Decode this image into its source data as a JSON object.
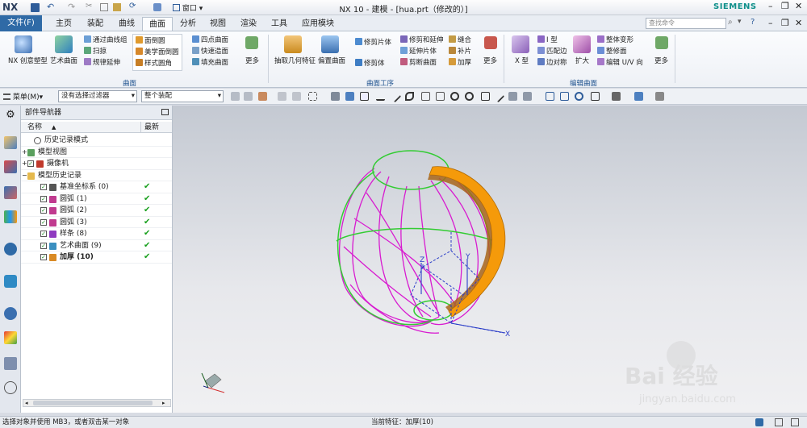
{
  "app": {
    "logo": "NX",
    "title": "NX 10 - 建模 - [hua.prt（修改的）]",
    "brand": "SIEMENS",
    "window_menu": "窗口",
    "search_placeholder": "查找命令"
  },
  "menu": {
    "file": "文件(F)",
    "tabs": [
      "主页",
      "装配",
      "曲线",
      "曲面",
      "分析",
      "视图",
      "渲染",
      "工具",
      "应用模块"
    ]
  },
  "ribbon": {
    "creative": "NX 创意塑型",
    "art_surface": "艺术曲面",
    "through_curve_group": "通过曲线组",
    "sweep": "扫掠",
    "rule_extend": "规律延伸",
    "face_round": "面倒圆",
    "aesthetic_round": "美学面倒圆",
    "style_round": "样式圆角",
    "four_point": "四点曲面",
    "quick_build": "快速造面",
    "fill_surface": "填充曲面",
    "more": "更多",
    "extract_geometry": "抽取几何特征",
    "offset_surface": "偏置曲面",
    "trim_sheet": "修剪片体",
    "trim_extend": "修剪和延伸",
    "stitch": "缝合",
    "trim_body": "修剪体",
    "extend_sheet": "延伸片体",
    "patch": "补片",
    "delete_edge": "剪断曲面",
    "thicken": "加厚",
    "x_form": "X 型",
    "i_form": "I 型",
    "match_edge": "匹配边",
    "edge_symmetry": "边对称",
    "enlarge": "扩大",
    "global_shaping": "整体变形",
    "edit_surface": "整修面",
    "edit_uv": "编辑 U/V 向",
    "group_surface": "曲面",
    "group_surface_ops": "曲面工序",
    "group_edit_surface": "编辑曲面"
  },
  "toolbar": {
    "menu": "菜单(M)▾",
    "filter": "没有选择过滤器",
    "scope": "整个装配"
  },
  "navigator": {
    "title": "部件导航器",
    "col_name": "名称",
    "col_latest": "最新",
    "rows": [
      {
        "label": "历史记录模式",
        "check": ""
      },
      {
        "label": "模型视图",
        "check": ""
      },
      {
        "label": "摄像机",
        "check": ""
      },
      {
        "label": "模型历史记录",
        "check": ""
      },
      {
        "label": "基准坐标系 (0)",
        "check": "✔"
      },
      {
        "label": "圆弧 (1)",
        "check": "✔"
      },
      {
        "label": "圆弧 (2)",
        "check": "✔"
      },
      {
        "label": "圆弧 (3)",
        "check": "✔"
      },
      {
        "label": "样条 (8)",
        "check": "✔"
      },
      {
        "label": "艺术曲面 (9)",
        "check": "✔"
      },
      {
        "label": "加厚 (10)",
        "check": "✔"
      }
    ]
  },
  "viewport": {
    "axis_x": "X",
    "axis_y": "Y",
    "axis_z": "Z"
  },
  "watermark": {
    "main": "Bai 经验",
    "sub": "jingyan.baidu.com"
  },
  "status": {
    "left": "选择对象并使用 MB3，或者双击某一对象",
    "center": "当前特征：加厚(10)"
  },
  "colors": {
    "accent": "#2f6aa6",
    "curve_magenta": "#d81bd0",
    "curve_green": "#33cc33",
    "surface_orange": "#f59a0a"
  }
}
